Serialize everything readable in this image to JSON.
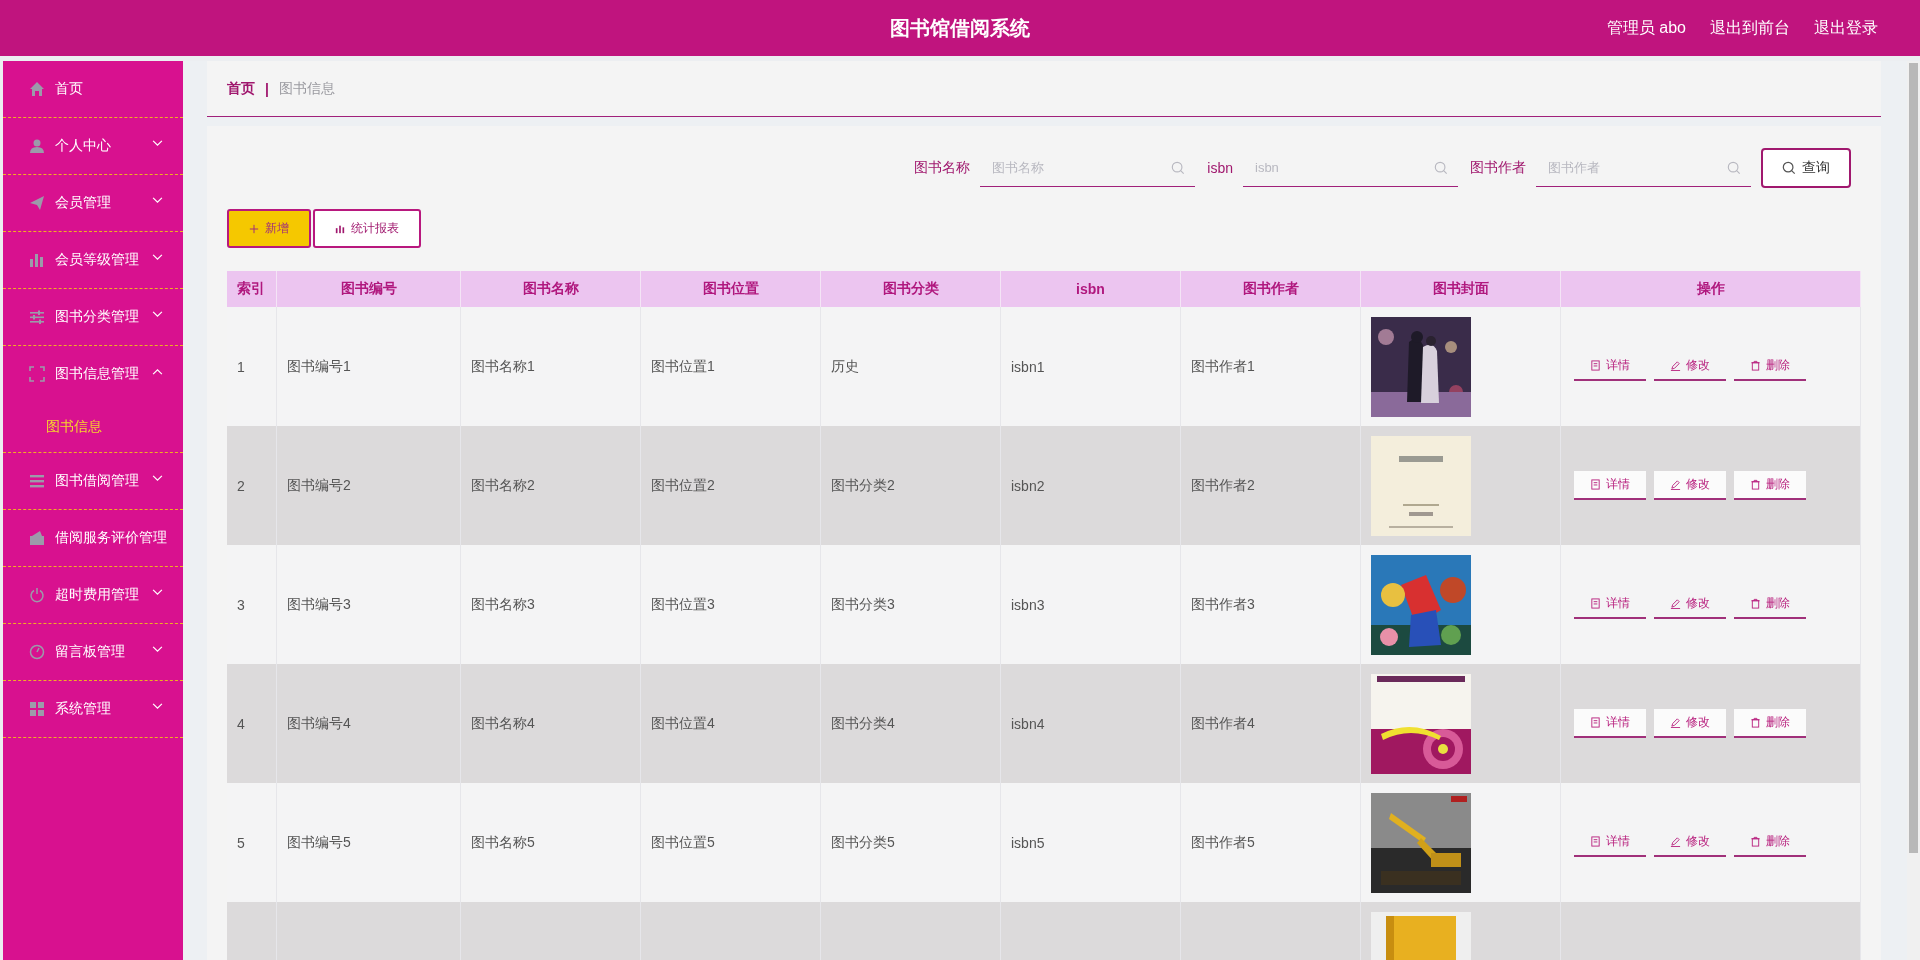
{
  "header": {
    "title": "图书馆借阅系统",
    "user": "管理员 abo",
    "links": [
      "退出到前台",
      "退出登录"
    ]
  },
  "sidebar": {
    "items": [
      {
        "label": "首页",
        "kind": "link",
        "selected": false
      },
      {
        "label": "个人中心",
        "kind": "menu",
        "expanded": false,
        "selected": false
      },
      {
        "label": "会员管理",
        "kind": "menu",
        "expanded": false,
        "selected": false
      },
      {
        "label": "会员等级管理",
        "kind": "menu",
        "expanded": false,
        "selected": false
      },
      {
        "label": "图书分类管理",
        "kind": "menu",
        "expanded": false,
        "selected": false
      },
      {
        "label": "图书信息管理",
        "kind": "menu",
        "expanded": true,
        "selected": false,
        "children": [
          {
            "label": "图书信息",
            "selected": true
          }
        ]
      },
      {
        "label": "图书借阅管理",
        "kind": "menu",
        "expanded": false,
        "selected": false
      },
      {
        "label": "借阅服务评价管理",
        "kind": "link",
        "selected": false
      },
      {
        "label": "超时费用管理",
        "kind": "menu",
        "expanded": false,
        "selected": false
      },
      {
        "label": "留言板管理",
        "kind": "menu",
        "expanded": false,
        "selected": false
      },
      {
        "label": "系统管理",
        "kind": "menu",
        "expanded": false,
        "selected": false
      }
    ]
  },
  "breadcrumb": {
    "home": "首页",
    "separator": "|",
    "current": "图书信息"
  },
  "search": {
    "fields": [
      {
        "label": "图书名称",
        "placeholder": "图书名称"
      },
      {
        "label": "isbn",
        "placeholder": "isbn"
      },
      {
        "label": "图书作者",
        "placeholder": "图书作者"
      }
    ],
    "button": "查询"
  },
  "actions": [
    {
      "label": "新增",
      "kind": "add"
    },
    {
      "label": "统计报表",
      "kind": "report"
    }
  ],
  "table": {
    "columns": [
      "索引",
      "图书编号",
      "图书名称",
      "图书位置",
      "图书分类",
      "isbn",
      "图书作者",
      "图书封面",
      "操作"
    ],
    "rows": [
      {
        "cells": [
          "1",
          "图书编号1",
          "图书名称1",
          "图书位置1",
          "历史",
          "isbn1",
          "图书作者1"
        ],
        "cover": {
          "kind": "picture"
        },
        "actions": [
          "详情",
          "修改",
          "删除"
        ]
      },
      {
        "cells": [
          "2",
          "图书编号2",
          "图书名称2",
          "图书位置2",
          "图书分类2",
          "isbn2",
          "图书作者2"
        ],
        "cover": {
          "kind": "picture"
        },
        "actions": [
          "详情",
          "修改",
          "删除"
        ]
      },
      {
        "cells": [
          "3",
          "图书编号3",
          "图书名称3",
          "图书位置3",
          "图书分类3",
          "isbn3",
          "图书作者3"
        ],
        "cover": {
          "kind": "picture"
        },
        "actions": [
          "详情",
          "修改",
          "删除"
        ]
      },
      {
        "cells": [
          "4",
          "图书编号4",
          "图书名称4",
          "图书位置4",
          "图书分类4",
          "isbn4",
          "图书作者4"
        ],
        "cover": {
          "kind": "picture"
        },
        "actions": [
          "详情",
          "修改",
          "删除"
        ]
      },
      {
        "cells": [
          "5",
          "图书编号5",
          "图书名称5",
          "图书位置5",
          "图书分类5",
          "isbn5",
          "图书作者5"
        ],
        "cover": {
          "kind": "picture"
        },
        "actions": [
          "详情",
          "修改",
          "删除"
        ]
      },
      {
        "cover": {
          "kind": "picture"
        }
      }
    ]
  }
}
